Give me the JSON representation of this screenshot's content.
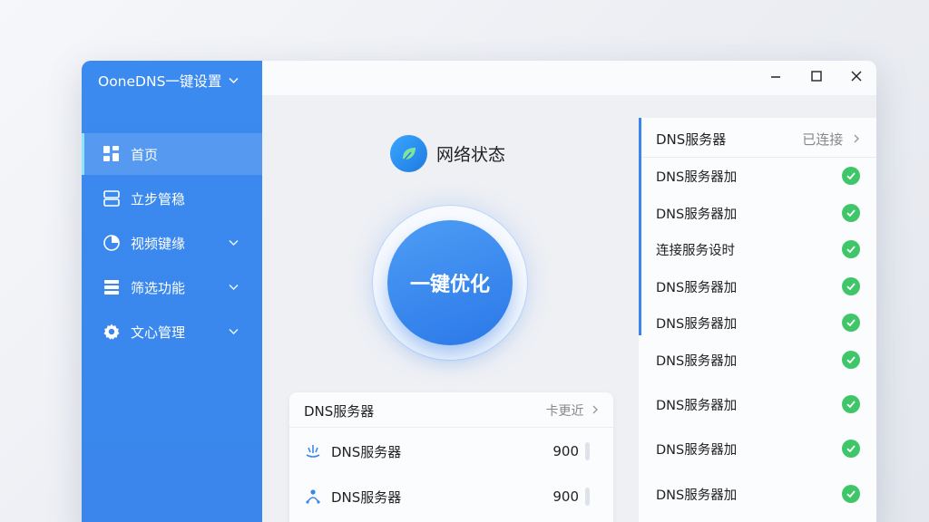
{
  "app": {
    "title": "OoneDNS一键设置"
  },
  "sidebar": {
    "items": [
      {
        "label": "首页",
        "icon": "grid-icon",
        "active": true,
        "has_chevron": false
      },
      {
        "label": "立步管稳",
        "icon": "server-icon",
        "active": false,
        "has_chevron": false
      },
      {
        "label": "视频键缘",
        "icon": "clock-pie-icon",
        "active": false,
        "has_chevron": true
      },
      {
        "label": "筛选功能",
        "icon": "list-icon",
        "active": false,
        "has_chevron": true
      },
      {
        "label": "文心管理",
        "icon": "gear-icon",
        "active": false,
        "has_chevron": true
      }
    ]
  },
  "window_controls": {
    "minimize": "—",
    "maximize": "☐",
    "close": "✕"
  },
  "status": {
    "title": "网络状态"
  },
  "optimize": {
    "label": "一键优化"
  },
  "server_card": {
    "title": "DNS服务器",
    "link": "卡更近",
    "rows": [
      {
        "label": "DNS服务器",
        "value": "900",
        "icon": "signal-icon"
      },
      {
        "label": "DNS服务器",
        "value": "900",
        "icon": "user-network-icon"
      }
    ]
  },
  "right_panel": {
    "title": "DNS服务器",
    "status": "已连接",
    "rows": [
      {
        "label": "DNS服务器加"
      },
      {
        "label": "DNS服务器加"
      },
      {
        "label": "连接服务设时"
      },
      {
        "label": "DNS服务器加"
      },
      {
        "label": "DNS服务器加"
      },
      {
        "label": "DNS服务器加"
      },
      {
        "label": "DNS服务器加"
      },
      {
        "label": "DNS服务器加"
      },
      {
        "label": "DNS服务器加"
      }
    ]
  },
  "colors": {
    "accent": "#3a86ec",
    "success": "#3fc669",
    "sidebar": "#3b8aef"
  }
}
